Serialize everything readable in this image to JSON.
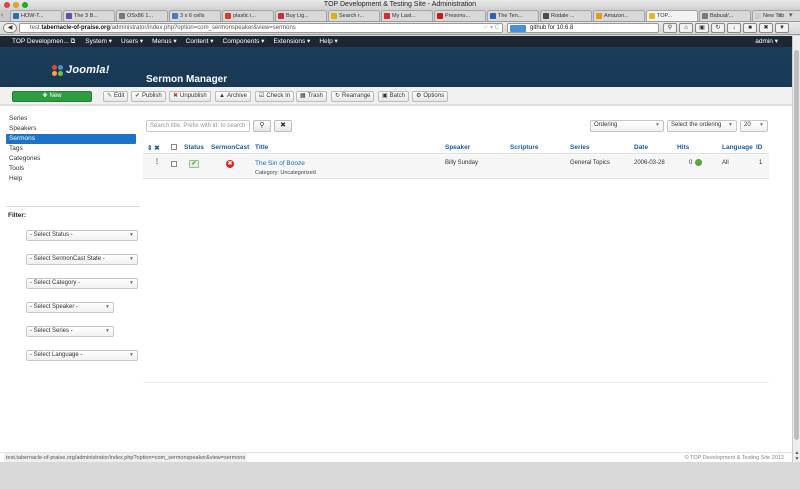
{
  "window": {
    "title": "TOP Development & Testing Site - Administration"
  },
  "browser": {
    "tabs": [
      {
        "label": "HOW-T...",
        "color": "#2b6cb5"
      },
      {
        "label": "The 3 B...",
        "color": "#6a4cb0"
      },
      {
        "label": "OSx86 1...",
        "color": "#777777"
      },
      {
        "label": "3 x 6 cells",
        "color": "#4b79c8"
      },
      {
        "label": "plastic i...",
        "color": "#d33b2c"
      },
      {
        "label": "Buy Lig...",
        "color": "#c43131"
      },
      {
        "label": "Search r...",
        "color": "#e4b000"
      },
      {
        "label": "My Last...",
        "color": "#d02f2f"
      },
      {
        "label": "Presonu...",
        "color": "#c91a1a"
      },
      {
        "label": "The Ten...",
        "color": "#2e64b8"
      },
      {
        "label": "Rodale ...",
        "color": "#4a4a4a"
      },
      {
        "label": "Amazon...",
        "color": "#e39b1b"
      },
      {
        "label": "TOP...",
        "color": "#e2b826",
        "active": true
      },
      {
        "label": "Babual/...",
        "color": "#7a7a7a"
      },
      {
        "label": "New Tab",
        "color": "#cccccc"
      }
    ],
    "url_prefix": "test.",
    "url_domain": "tabernacle-of-praise.org",
    "url_path": "/administrator/index.php?option=com_sermonspeaker&view=sermons",
    "search_text": "github for 10.6.8"
  },
  "navbar": {
    "brand": "TOP Developmen... ⧉",
    "menus": [
      "System ▾",
      "Users ▾",
      "Menus ▾",
      "Content ▾",
      "Components ▾",
      "Extensions ▾",
      "Help ▾"
    ],
    "user": "admin ▾"
  },
  "header": {
    "logo_text": "Joomla!",
    "title": "Sermon Manager"
  },
  "toolbar": {
    "new": "New",
    "edit": "Edit",
    "publish": "Publish",
    "unpublish": "Unpublish",
    "archive": "Archive",
    "checkin": "Check In",
    "trash": "Trash",
    "rearrange": "Rearrange",
    "batch": "Batch",
    "options": "Options"
  },
  "sidebar": {
    "items": [
      "Series",
      "Speakers",
      "Sermons",
      "Tags",
      "Categories",
      "Tools",
      "Help"
    ],
    "active_index": 2
  },
  "filters": {
    "title": "Filter:",
    "selects": [
      "- Select Status -",
      "- Select SermonCast State -",
      "- Select Category -",
      "- Select Speaker -",
      "- Select Series -",
      "- Select Language -"
    ]
  },
  "list": {
    "search_placeholder": "Search title. Prefix with id: to search",
    "ordering_label": "Ordering",
    "ordering_select": "Select the ordering",
    "limit": "20",
    "columns": {
      "status": "Status",
      "sermoncast": "SermonCast",
      "title": "Title",
      "speaker": "Speaker",
      "scripture": "Scripture",
      "series": "Series",
      "date": "Date",
      "hits": "Hits",
      "language": "Language",
      "id": "ID"
    },
    "rows": [
      {
        "title": "The Sin of Booze",
        "category": "Category: Uncategorized",
        "speaker": "Billy Sunday",
        "scripture": "",
        "series": "General Topics",
        "date": "2006-03-28",
        "hits": "0",
        "language": "All",
        "id": "1"
      }
    ]
  },
  "status": {
    "url": "test.tabernacle-of-praise.org/administrator/index.php?option=com_sermonspeaker&view=sermons",
    "copyright": "© TOP Development & Testing Site 2012"
  }
}
